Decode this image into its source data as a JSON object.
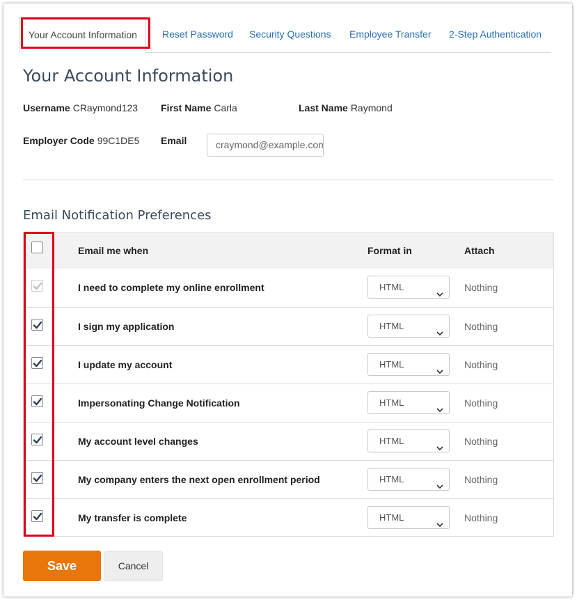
{
  "tabs": [
    {
      "label": "Your Account Information",
      "active": true
    },
    {
      "label": "Reset Password"
    },
    {
      "label": "Security Questions"
    },
    {
      "label": "Employee Transfer"
    },
    {
      "label": "2-Step Authentication"
    }
  ],
  "page_title": "Your Account Information",
  "account": {
    "username_label": "Username",
    "username": "CRaymond123",
    "first_name_label": "First Name",
    "first_name": "Carla",
    "last_name_label": "Last Name",
    "last_name": "Raymond",
    "employer_code_label": "Employer Code",
    "employer_code": "99C1DE5",
    "email_label": "Email",
    "email": "craymond@example.com"
  },
  "section_title": "Email Notification Preferences",
  "table": {
    "headers": {
      "email_me_when": "Email me when",
      "format_in": "Format in",
      "attach": "Attach"
    },
    "select_all_checked": false,
    "rows": [
      {
        "label": "I need to complete my online enrollment",
        "checked": true,
        "disabled": true,
        "format": "HTML",
        "attach": "Nothing"
      },
      {
        "label": "I sign my application",
        "checked": true,
        "disabled": false,
        "format": "HTML",
        "attach": "Nothing"
      },
      {
        "label": "I update my account",
        "checked": true,
        "disabled": false,
        "format": "HTML",
        "attach": "Nothing"
      },
      {
        "label": "Impersonating Change Notification",
        "checked": true,
        "disabled": false,
        "format": "HTML",
        "attach": "Nothing"
      },
      {
        "label": "My account level changes",
        "checked": true,
        "disabled": false,
        "format": "HTML",
        "attach": "Nothing"
      },
      {
        "label": "My company enters the next open enrollment period",
        "checked": true,
        "disabled": false,
        "format": "HTML",
        "attach": "Nothing"
      },
      {
        "label": "My transfer is complete",
        "checked": true,
        "disabled": false,
        "format": "HTML",
        "attach": "Nothing"
      }
    ]
  },
  "buttons": {
    "save": "Save",
    "cancel": "Cancel"
  },
  "colors": {
    "accent": "#e8760a",
    "link": "#2a6fb8",
    "highlight": "#e0001b",
    "check": "#2c3e5a"
  }
}
